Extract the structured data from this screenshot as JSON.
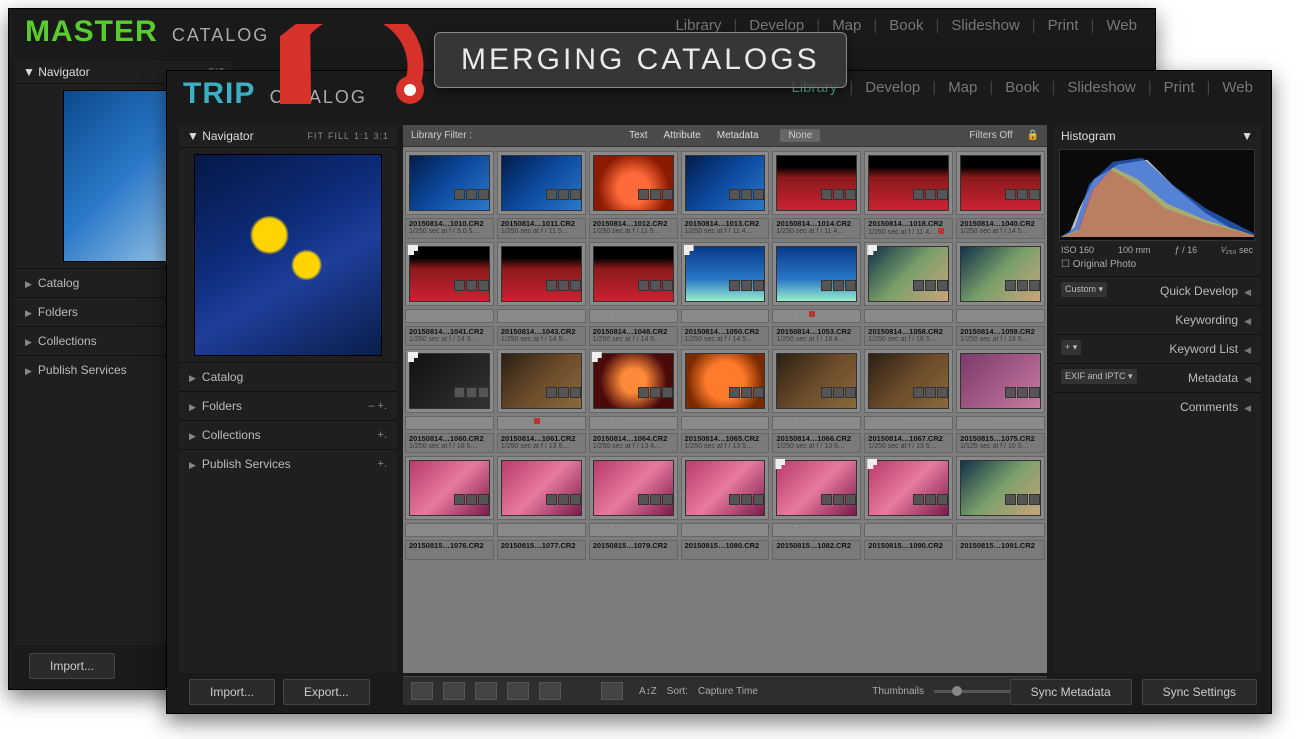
{
  "overlay": {
    "banner": "MERGING CATALOGS"
  },
  "master": {
    "title_big": "MASTER",
    "title_small": "CATALOG",
    "module_nav": [
      "Library",
      "Develop",
      "Map",
      "Book",
      "Slideshow",
      "Print",
      "Web"
    ],
    "navigator": {
      "label": "Navigator",
      "opts": [
        "FIT"
      ]
    },
    "left_sections": [
      "Catalog",
      "Folders",
      "Collections",
      "Publish Services"
    ],
    "import_btn": "Import..."
  },
  "trip": {
    "title_big": "TRIP",
    "title_small": "CATALOG",
    "module_nav": [
      "Library",
      "Develop",
      "Map",
      "Book",
      "Slideshow",
      "Print",
      "Web"
    ],
    "module_active": "Library",
    "navigator": {
      "label": "Navigator",
      "opts": [
        "FIT",
        "FILL",
        "1:1",
        "3:1"
      ]
    },
    "left_sections": [
      {
        "label": "Catalog",
        "pm": ""
      },
      {
        "label": "Folders",
        "pm": "–  +."
      },
      {
        "label": "Collections",
        "pm": "+."
      },
      {
        "label": "Publish Services",
        "pm": "+."
      }
    ],
    "import_btn": "Import...",
    "export_btn": "Export...",
    "filterbar": {
      "label": "Library Filter :",
      "items": [
        "Text",
        "Attribute",
        "Metadata"
      ],
      "none": "None",
      "filters_off": "Filters Off"
    },
    "toolbar": {
      "sort_label": "Sort:",
      "sort_value": "Capture Time",
      "thumbs_label": "Thumbnails"
    },
    "right": {
      "histogram_label": "Histogram",
      "histo_meta": [
        "ISO 160",
        "100 mm",
        "ƒ / 16",
        "¹⁄₂₅₀ sec"
      ],
      "orig": "Original Photo",
      "sections": [
        {
          "tag": "Custom",
          "label": "Quick Develop"
        },
        {
          "tag": "",
          "label": "Keywording"
        },
        {
          "tag": "+",
          "label": "Keyword List"
        },
        {
          "tag": "EXIF and IPTC",
          "label": "Metadata"
        },
        {
          "tag": "",
          "label": "Comments"
        }
      ],
      "sync_meta": "Sync Metadata",
      "sync_set": "Sync Settings"
    },
    "grid": [
      {
        "kind": "thumbs",
        "cells": [
          {
            "cls": "c-blue"
          },
          {
            "cls": "c-blue"
          },
          {
            "cls": "c-red"
          },
          {
            "cls": "c-blue"
          },
          {
            "cls": "c-redfan"
          },
          {
            "cls": "c-redfan"
          },
          {
            "cls": "c-redfan"
          }
        ]
      },
      {
        "kind": "caption",
        "cells": [
          {
            "fn": "20150814…1010.CR2",
            "ex": "1/250 sec at f / 9.0   5…"
          },
          {
            "fn": "20150814…1011.CR2",
            "ex": "1/250 sec at f / 11    5…"
          },
          {
            "fn": "20150814…1012.CR2",
            "ex": "1/250 sec at f / 11    5…"
          },
          {
            "fn": "20150814…1013.CR2",
            "ex": "1/250 sec at f / 11    4…"
          },
          {
            "fn": "20150814…1014.CR2",
            "ex": "1/250 sec at f / 11    4…"
          },
          {
            "fn": "20150814…1018.CR2",
            "ex": "1/250 sec at f / 11    4…",
            "red": true
          },
          {
            "fn": "20150814…1040.CR2",
            "ex": "1/250 sec at f / 14    5…"
          }
        ]
      },
      {
        "kind": "thumbs",
        "cells": [
          {
            "cls": "c-redfan",
            "flag": true
          },
          {
            "cls": "c-redfan"
          },
          {
            "cls": "c-redfan"
          },
          {
            "cls": "c-underblue",
            "flag": true
          },
          {
            "cls": "c-underblue"
          },
          {
            "cls": "c-corals",
            "flag": true
          },
          {
            "cls": "c-corals"
          }
        ]
      },
      {
        "kind": "dots",
        "cells": [
          {
            "red": false
          },
          {
            "red": false
          },
          {
            "red": false
          },
          {
            "red": false
          },
          {
            "red": true
          },
          {
            "red": false
          },
          {
            "red": false
          }
        ]
      },
      {
        "kind": "caption",
        "cells": [
          {
            "fn": "20150814…1041.CR2",
            "ex": "1/250 sec at f / 14    3…"
          },
          {
            "fn": "20150814…1043.CR2",
            "ex": "1/250 sec at f / 14    5…"
          },
          {
            "fn": "20150814…1048.CR2",
            "ex": "1/250 sec at f / 14    5…"
          },
          {
            "fn": "20150814…1050.CR2",
            "ex": "1/250 sec at f / 14    5…"
          },
          {
            "fn": "20150814…1053.CR2",
            "ex": "1/250 sec at f / 18    4…"
          },
          {
            "fn": "20150814…1058.CR2",
            "ex": "1/250 sec at f / 18    5…"
          },
          {
            "fn": "20150814…1059.CR2",
            "ex": "1/250 sec at f / 18    5…"
          }
        ]
      },
      {
        "kind": "thumbs",
        "cells": [
          {
            "cls": "c-dark",
            "flag": true
          },
          {
            "cls": "c-brown"
          },
          {
            "cls": "c-star",
            "flag": true
          },
          {
            "cls": "c-orange"
          },
          {
            "cls": "c-brown"
          },
          {
            "cls": "c-brown"
          },
          {
            "cls": "c-mag"
          }
        ]
      },
      {
        "kind": "dots",
        "cells": [
          {
            "red": false
          },
          {
            "red": true
          },
          {
            "red": false
          },
          {
            "red": false
          },
          {
            "red": false
          },
          {
            "red": false
          },
          {
            "red": false
          }
        ]
      },
      {
        "kind": "caption",
        "cells": [
          {
            "fn": "20150814…1060.CR2",
            "ex": "1/250 sec at f / 18    5…"
          },
          {
            "fn": "20150814…1061.CR2",
            "ex": "1/250 sec at f / 13    5…"
          },
          {
            "fn": "20150814…1064.CR2",
            "ex": "1/250 sec at f / 13    4…"
          },
          {
            "fn": "20150814…1065.CR2",
            "ex": "1/250 sec at f / 13    5…"
          },
          {
            "fn": "20150814…1066.CR2",
            "ex": "1/250 sec at f / 13    5…"
          },
          {
            "fn": "20150814…1067.CR2",
            "ex": "1/250 sec at f / 13    5…"
          },
          {
            "fn": "20150815…1075.CR2",
            "ex": "1/125 sec at f / 10    5…"
          }
        ]
      },
      {
        "kind": "thumbs",
        "cells": [
          {
            "cls": "c-pink"
          },
          {
            "cls": "c-pink"
          },
          {
            "cls": "c-pink"
          },
          {
            "cls": "c-pink"
          },
          {
            "cls": "c-pink",
            "flag": true
          },
          {
            "cls": "c-pink",
            "flag": true
          },
          {
            "cls": "c-corals"
          }
        ]
      },
      {
        "kind": "dots",
        "cells": [
          {},
          {},
          {},
          {},
          {},
          {},
          {}
        ]
      },
      {
        "kind": "caption",
        "cells": [
          {
            "fn": "20150815…1076.CR2",
            "ex": ""
          },
          {
            "fn": "20150815…1077.CR2",
            "ex": ""
          },
          {
            "fn": "20150815…1079.CR2",
            "ex": ""
          },
          {
            "fn": "20150815…1080.CR2",
            "ex": ""
          },
          {
            "fn": "20150815…1082.CR2",
            "ex": ""
          },
          {
            "fn": "20150815…1090.CR2",
            "ex": ""
          },
          {
            "fn": "20150815…1091.CR2",
            "ex": ""
          }
        ]
      }
    ]
  }
}
